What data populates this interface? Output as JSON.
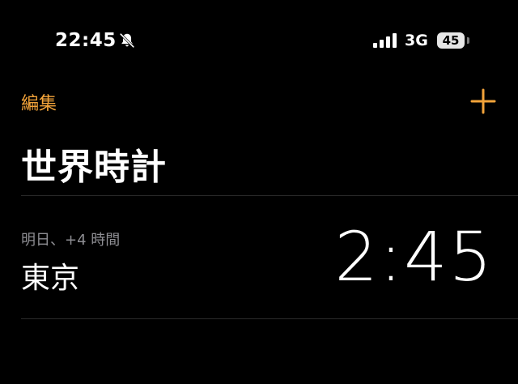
{
  "status_bar": {
    "time": "22:45",
    "network": "3G",
    "battery": "45",
    "icons": [
      "bell-slash-icon",
      "cellular-signal-icon",
      "battery-icon"
    ]
  },
  "nav": {
    "edit_label": "編集",
    "add_icon": "plus-icon"
  },
  "title": "世界時計",
  "clocks": [
    {
      "offset_label": "明日、+4 時間",
      "city": "東京",
      "time": "2:45"
    }
  ],
  "colors": {
    "background": "#000000",
    "accent": "#f2a33a",
    "secondary_text": "#8e8e93",
    "divider": "#2a2a2a"
  }
}
